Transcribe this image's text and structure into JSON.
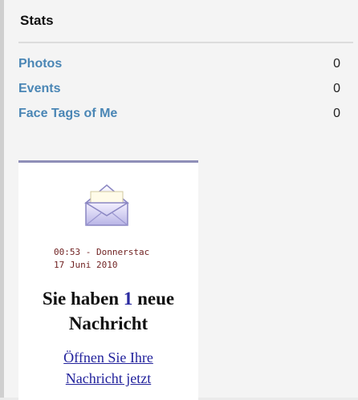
{
  "stats": {
    "title": "Stats",
    "rows": [
      {
        "label": "Photos",
        "count": "0"
      },
      {
        "label": "Events",
        "count": "0"
      },
      {
        "label": "Face Tags of Me",
        "count": "0"
      }
    ]
  },
  "ad": {
    "icon": "envelope-icon",
    "time_line": "00:53 - Donnerstac",
    "date_line": "17 Juni 2010",
    "headline_before": "Sie haben ",
    "headline_number": "1",
    "headline_after": " neue",
    "headline_line2": "Nachricht",
    "link_line1": "Öffnen Sie Ihre",
    "link_line2": "Nachricht jetzt",
    "colors": {
      "link": "#4a86b5",
      "ad_border": "#8f8fb8",
      "datetime": "#6e1f1f",
      "ad_link": "#22229c"
    }
  }
}
